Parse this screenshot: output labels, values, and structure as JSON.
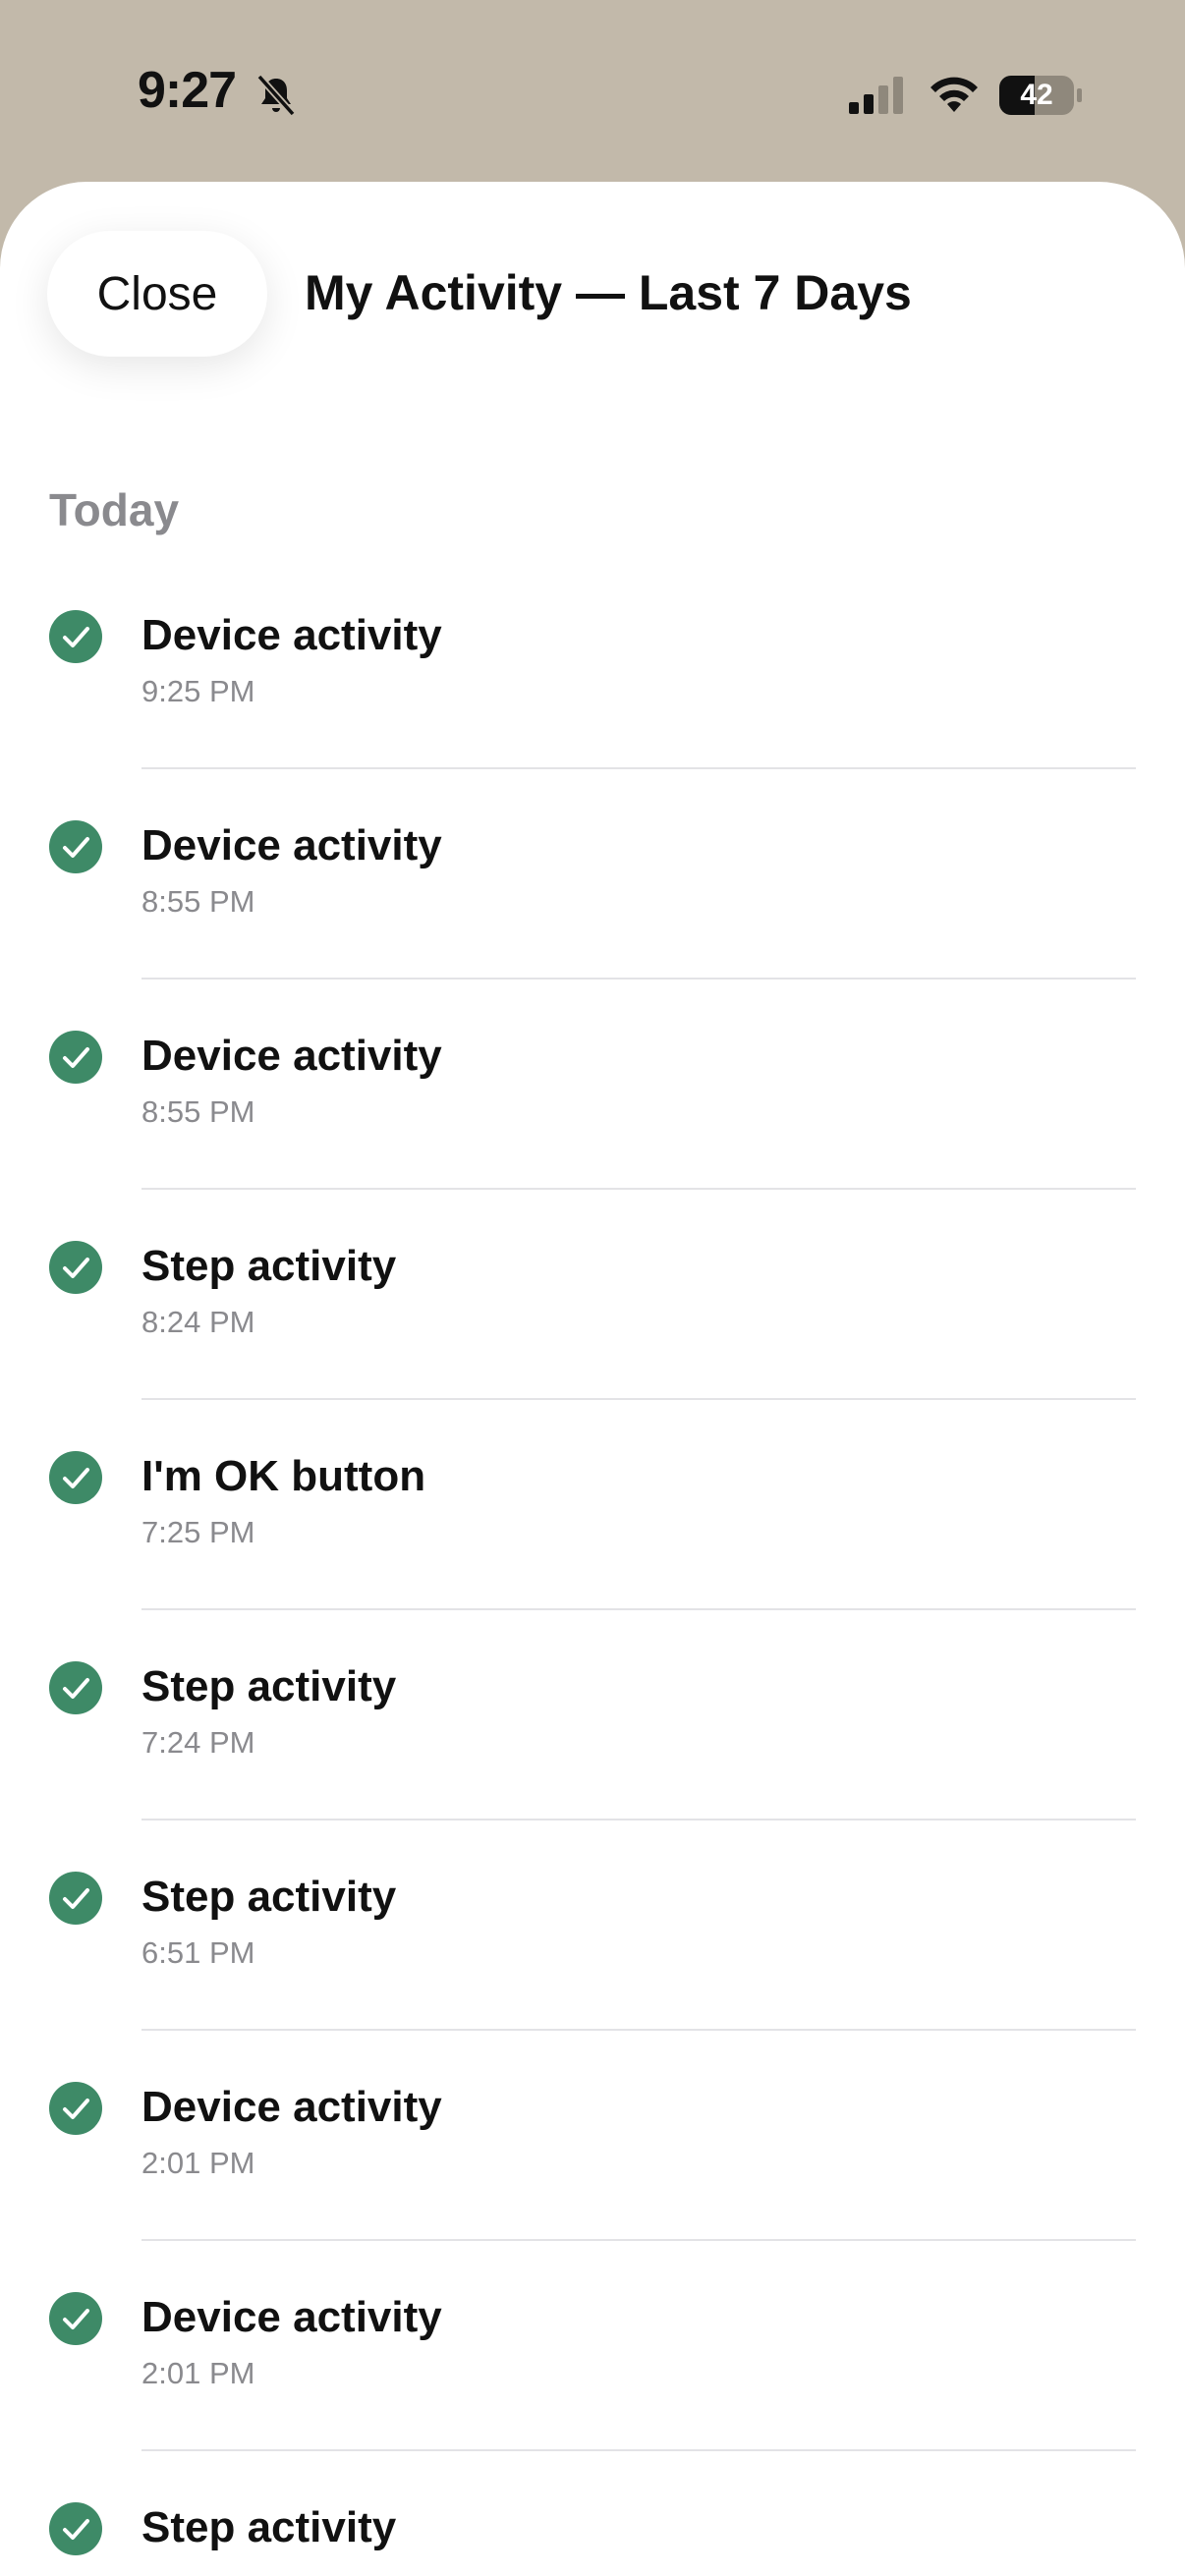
{
  "status_bar": {
    "time": "9:27",
    "battery": "42",
    "icons": [
      "bell-slash-icon",
      "cellular-signal-icon",
      "wifi-icon",
      "battery-icon"
    ]
  },
  "header": {
    "close_label": "Close",
    "title": "My Activity — Last 7 Days"
  },
  "section": {
    "title": "Today"
  },
  "activities": [
    {
      "title": "Device activity",
      "time": "9:25 PM"
    },
    {
      "title": "Device activity",
      "time": "8:55 PM"
    },
    {
      "title": "Device activity",
      "time": "8:55 PM"
    },
    {
      "title": "Step activity",
      "time": "8:24 PM"
    },
    {
      "title": "I'm OK button",
      "time": "7:25 PM"
    },
    {
      "title": "Step activity",
      "time": "7:24 PM"
    },
    {
      "title": "Step activity",
      "time": "6:51 PM"
    },
    {
      "title": "Device activity",
      "time": "2:01 PM"
    },
    {
      "title": "Device activity",
      "time": "2:01 PM"
    },
    {
      "title": "Step activity",
      "time": ""
    }
  ],
  "colors": {
    "accent_green": "#3e8a67",
    "header_bg": "#c2b9aa",
    "secondary_text": "#8a8a8e"
  },
  "icons": {
    "row_icon": "check-circle-icon"
  }
}
